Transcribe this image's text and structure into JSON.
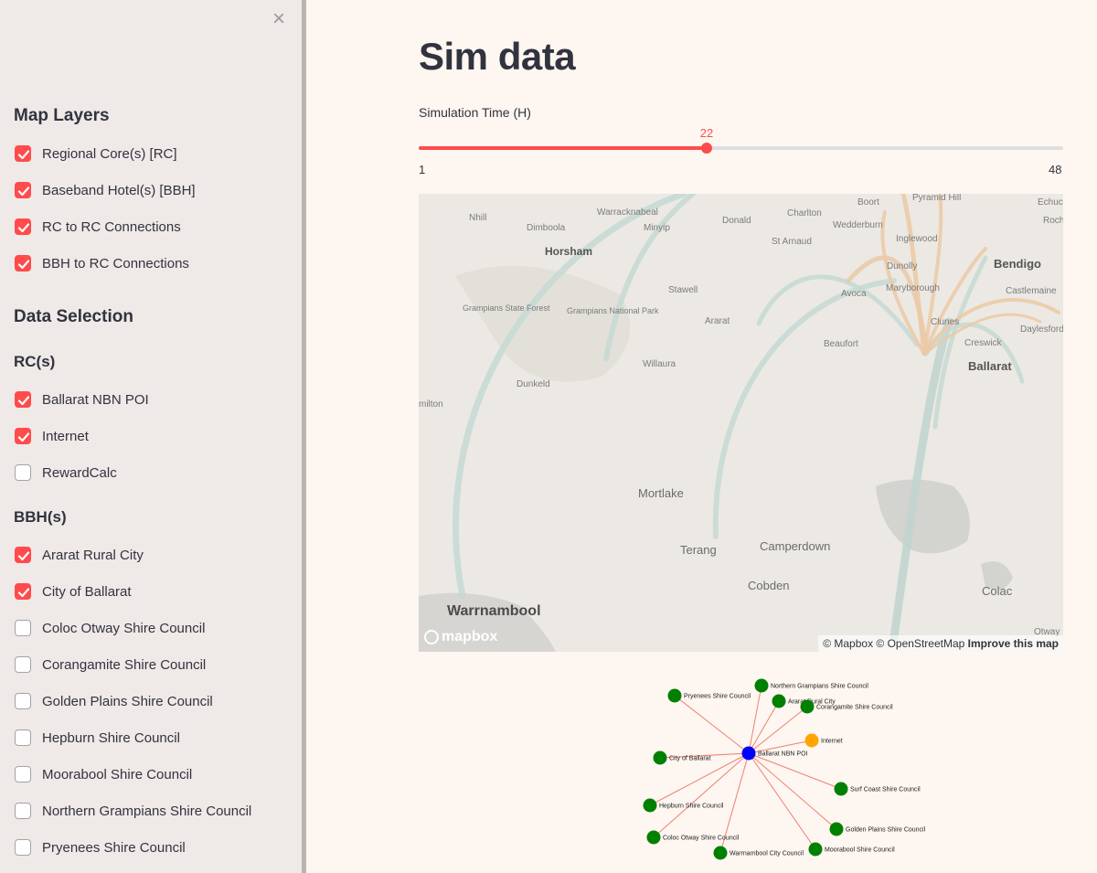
{
  "sidebar": {
    "close_icon": "×",
    "map_layers_title": "Map Layers",
    "map_layers": [
      {
        "label": "Regional Core(s) [RC]",
        "checked": true
      },
      {
        "label": "Baseband Hotel(s) [BBH]",
        "checked": true
      },
      {
        "label": "RC to RC Connections",
        "checked": true
      },
      {
        "label": "BBH to RC Connections",
        "checked": true
      }
    ],
    "data_selection_title": "Data Selection",
    "rc_title": "RC(s)",
    "rcs": [
      {
        "label": "Ballarat NBN POI",
        "checked": true
      },
      {
        "label": "Internet",
        "checked": true
      },
      {
        "label": "RewardCalc",
        "checked": false
      }
    ],
    "bbh_title": "BBH(s)",
    "bbhs": [
      {
        "label": "Ararat Rural City",
        "checked": true
      },
      {
        "label": "City of Ballarat",
        "checked": true
      },
      {
        "label": "Coloc Otway Shire Council",
        "checked": false
      },
      {
        "label": "Corangamite Shire Council",
        "checked": false
      },
      {
        "label": "Golden Plains Shire Council",
        "checked": false
      },
      {
        "label": "Hepburn Shire Council",
        "checked": false
      },
      {
        "label": "Moorabool Shire Council",
        "checked": false
      },
      {
        "label": "Northern Grampians Shire Council",
        "checked": false
      },
      {
        "label": "Pryenees Shire Council",
        "checked": false
      }
    ]
  },
  "main": {
    "title": "Sim data",
    "slider": {
      "label": "Simulation Time (H)",
      "value": 22,
      "min": 1,
      "max": 48,
      "value_text": "22",
      "min_text": "1",
      "max_text": "48"
    },
    "map": {
      "towns": [
        "Nhill",
        "Warracknabeal",
        "Donald",
        "Charlton",
        "Boort",
        "Pyramid Hill",
        "Echuca",
        "Dimboola",
        "Minyip",
        "Wedderburn",
        "Inglewood",
        "Horsham",
        "St Arnaud",
        "Dunolly",
        "Bendigo",
        "Stawell",
        "Avoca",
        "Maryborough",
        "Castlemaine",
        "Grampians State Forest",
        "Grampians National Park",
        "Ararat",
        "Clunes",
        "Daylesford",
        "Beaufort",
        "Creswick",
        "Ballarat",
        "Willaura",
        "Dunkeld",
        "milton",
        "Mortlake",
        "Terang",
        "Camperdown",
        "Cobden",
        "Warrnambool",
        "Colac",
        "Otway",
        "Rochester"
      ],
      "logo_text": "mapbox",
      "attribution": "© Mapbox © OpenStreetMap",
      "improve_link": "Improve this map"
    },
    "network": {
      "colors": {
        "center": "#0000ff",
        "internet": "#ffa500",
        "bbh": "#008000",
        "edge": "#f08070"
      },
      "center_label": "Ballarat NBN POI",
      "nodes": [
        {
          "label": "Northern Grampians Shire Council",
          "kind": "bbh"
        },
        {
          "label": "Pryenees Shire Council",
          "kind": "bbh"
        },
        {
          "label": "Ararat Rural City",
          "kind": "bbh"
        },
        {
          "label": "Corangamite Shire Council",
          "kind": "bbh"
        },
        {
          "label": "Internet",
          "kind": "internet"
        },
        {
          "label": "City of Ballarat",
          "kind": "bbh"
        },
        {
          "label": "Surf Coast Shire Council",
          "kind": "bbh"
        },
        {
          "label": "Hepburn Shire Council",
          "kind": "bbh"
        },
        {
          "label": "Golden Plains Shire Council",
          "kind": "bbh"
        },
        {
          "label": "Coloc Otway Shire Council",
          "kind": "bbh"
        },
        {
          "label": "Moorabool Shire Council",
          "kind": "bbh"
        },
        {
          "label": "Warrnambool City Council",
          "kind": "bbh"
        }
      ]
    }
  }
}
